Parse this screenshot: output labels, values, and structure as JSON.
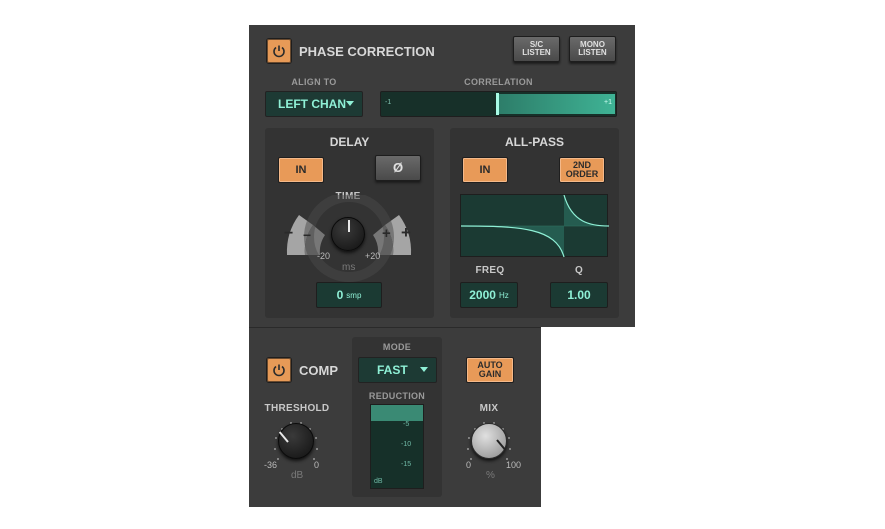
{
  "phase": {
    "title": "PHASE CORRECTION",
    "sc_listen": "S/C\nLISTEN",
    "mono_listen": "MONO\nLISTEN",
    "align_to_label": "ALIGN TO",
    "align_to_value": "LEFT CHAN",
    "correlation_label": "CORRELATION",
    "correlation_min": "-1",
    "correlation_max": "+1"
  },
  "delay": {
    "title": "DELAY",
    "in_label": "IN",
    "phase_invert_label": "Ø",
    "time_label": "TIME",
    "minus": "−",
    "plus": "+",
    "min_label": "-20",
    "max_label": "+20",
    "unit": "ms",
    "samples_value": "0",
    "samples_unit": "smp"
  },
  "allpass": {
    "title": "ALL-PASS",
    "in_label": "IN",
    "order_label": "2ND\nORDER",
    "freq_label": "FREQ",
    "q_label": "Q",
    "freq_value": "2000",
    "freq_unit": "Hz",
    "q_value": "1.00"
  },
  "comp": {
    "title": "COMP",
    "mode_label": "MODE",
    "mode_value": "FAST",
    "auto_gain": "AUTO\nGAIN",
    "reduction_label": "REDUCTION",
    "meter_ticks": [
      "-5",
      "-10",
      "-15"
    ],
    "meter_unit": "dB",
    "threshold_label": "THRESHOLD",
    "threshold_min": "-36",
    "threshold_max": "0",
    "threshold_unit": "dB",
    "mix_label": "MIX",
    "mix_min": "0",
    "mix_max": "100",
    "mix_unit": "%"
  },
  "colors": {
    "accent_orange": "#e89a58",
    "display_green": "#8ff0d6",
    "panel": "#3c3c3c"
  }
}
